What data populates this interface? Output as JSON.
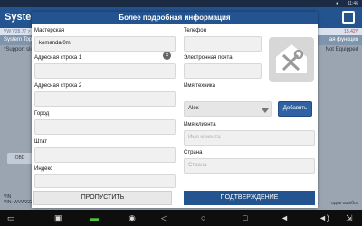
{
  "status_bar": {
    "time": "11:46",
    "signal": "●"
  },
  "app": {
    "title": "System an",
    "sub_left": "VW V28.77 > Мой",
    "sub_right": "15.42V",
    "tab_left": "System Topolo",
    "tab_right": "ая функция",
    "body_left": "*Support sliding",
    "body_right": "Not Equipped",
    "obd_label": "OBD",
    "vin_line1": "VIN",
    "vin_line2": "VIN: WVWZZZZY",
    "errors_text": "одов ошибок"
  },
  "dialog": {
    "title": "Более подробная информация",
    "workshop": {
      "label": "Мастерская",
      "value": "komanda 0m"
    },
    "address1": {
      "label": "Адресная строка 1",
      "value": ""
    },
    "address2": {
      "label": "Адресная строка 2",
      "value": ""
    },
    "city": {
      "label": "Город",
      "value": ""
    },
    "state": {
      "label": "Штат",
      "value": ""
    },
    "zip": {
      "label": "Индекс",
      "value": ""
    },
    "phone": {
      "label": "Телефон",
      "value": ""
    },
    "email": {
      "label": "Электронная почта",
      "value": ""
    },
    "technician": {
      "label": "Имя техника",
      "value": "Alex",
      "add_label": "Добавить"
    },
    "client_name": {
      "label": "Имя клиента",
      "placeholder": "Имя клиента"
    },
    "country": {
      "label": "Страна",
      "placeholder": "Страна"
    },
    "skip_label": "ПРОПУСТИТЬ",
    "confirm_label": "ПОДТВЕРЖДЕНИЕ"
  },
  "icons": {
    "avatar": "wrench-screwdriver-icon",
    "clear": "clear-icon",
    "dropdown": "chevron-down-icon",
    "nav_back": "back-icon",
    "nav_home": "home-icon",
    "nav_recent": "recent-apps-icon",
    "nav_screenshot": "screenshot-icon",
    "nav_camera": "camera-icon",
    "nav_volume": "volume-icon",
    "nav_gallery": "gallery-icon",
    "nav_vci": "vci-icon"
  },
  "colors": {
    "header": "#24548f",
    "accent_button": "#2f61a3",
    "vci": "#4cc43a"
  }
}
